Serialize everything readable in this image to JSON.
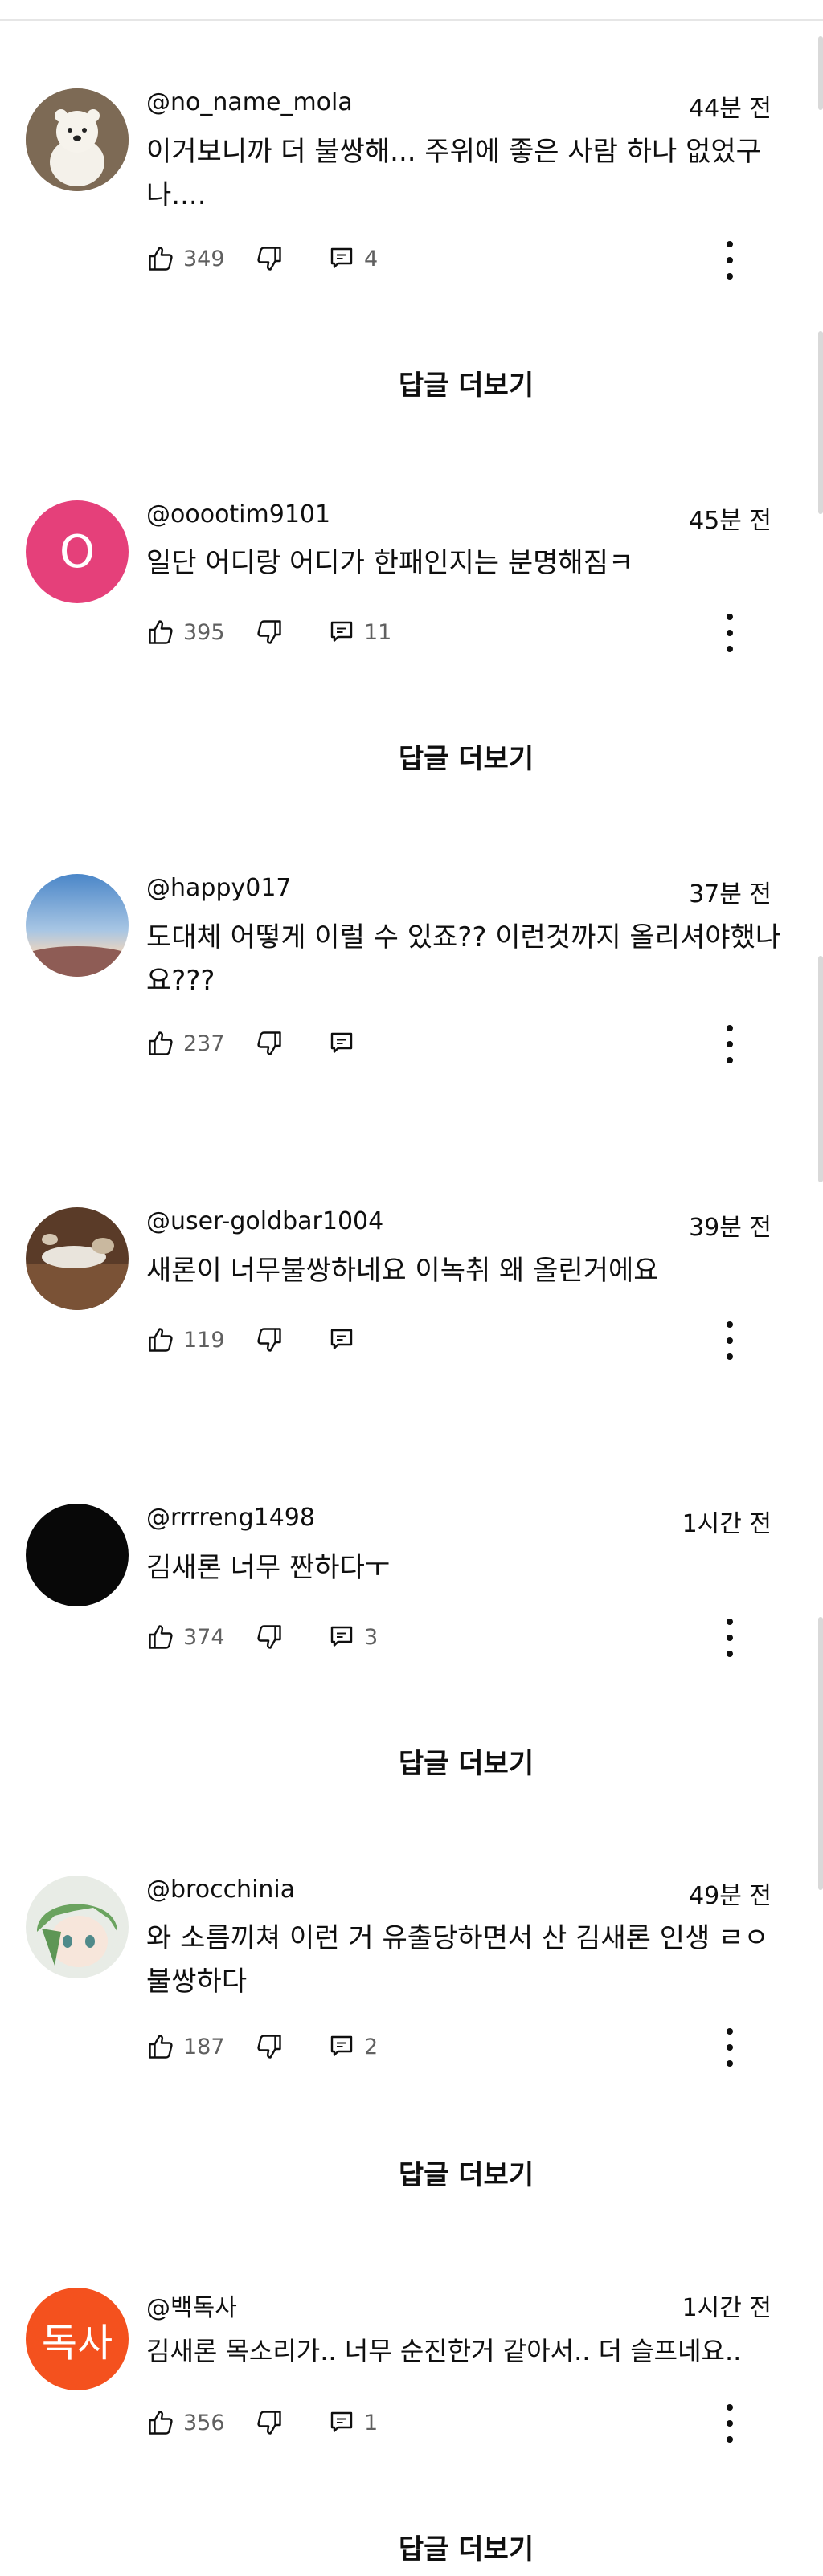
{
  "comments": [
    {
      "handle": "@no_name_mola",
      "time": "44분 전",
      "text": "이거보니까 더 불쌍해... 주위에 좋은 사람 하나 없었구나....",
      "likes": "349",
      "replies": "4",
      "avatar_letter": ""
    },
    {
      "handle": "@ooootim9101",
      "time": "45분 전",
      "text": "일단 어디랑 어디가 한패인지는 분명해짐ㅋ",
      "likes": "395",
      "replies": "11",
      "avatar_letter": "O"
    },
    {
      "handle": "@happy017",
      "time": "37분 전",
      "text": "도대체 어떻게 이럴 수 있죠?? 이런것까지 올리셔야했나요???",
      "likes": "237",
      "replies": "",
      "avatar_letter": ""
    },
    {
      "handle": "@user-goldbar1004",
      "time": "39분 전",
      "text": "새론이 너무불쌍하네요 이녹취 왜 올린거에요",
      "likes": "119",
      "replies": "",
      "avatar_letter": ""
    },
    {
      "handle": "@rrrreng1498",
      "time": "1시간 전",
      "text": "김새론 너무 짠하다ㅜ",
      "likes": "374",
      "replies": "3",
      "avatar_letter": ""
    },
    {
      "handle": "@brocchinia",
      "time": "49분 전",
      "text": "와 소름끼쳐 이런 거 유출당하면서 산 김새론 인생 ㄹㅇ 불쌍하다",
      "likes": "187",
      "replies": "2",
      "avatar_letter": ""
    },
    {
      "handle": "@백독사",
      "time": "1시간 전",
      "text": "김새론 목소리가.. 너무 순진한거 같아서.. 더 슬프네요..",
      "likes": "356",
      "replies": "1",
      "avatar_letter": "독사"
    }
  ],
  "reply_more_label": "답글 더보기",
  "colors": {
    "avatar_pink": "#e5407a",
    "avatar_orange": "#f4511e",
    "meta_gray": "#606060"
  }
}
